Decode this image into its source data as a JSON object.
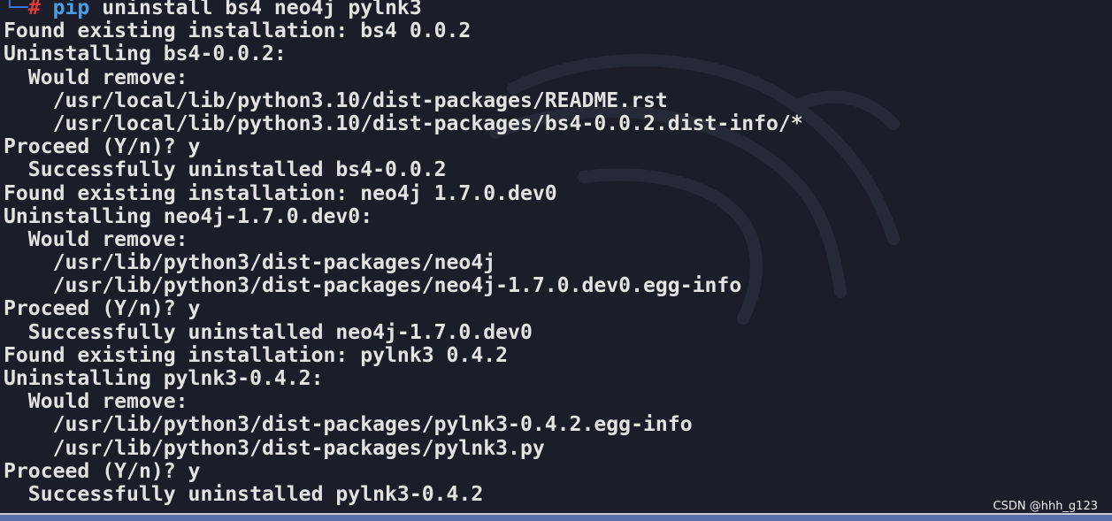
{
  "prompt": {
    "corner": "└─",
    "symbol": "#",
    "command_program": "pip",
    "command_args": " uninstall bs4 neo4j pylnk3"
  },
  "output_lines": [
    "Found existing installation: bs4 0.0.2",
    "Uninstalling bs4-0.0.2:",
    "  Would remove:",
    "    /usr/local/lib/python3.10/dist-packages/README.rst",
    "    /usr/local/lib/python3.10/dist-packages/bs4-0.0.2.dist-info/*",
    "Proceed (Y/n)? y",
    "  Successfully uninstalled bs4-0.0.2",
    "Found existing installation: neo4j 1.7.0.dev0",
    "Uninstalling neo4j-1.7.0.dev0:",
    "  Would remove:",
    "    /usr/lib/python3/dist-packages/neo4j",
    "    /usr/lib/python3/dist-packages/neo4j-1.7.0.dev0.egg-info",
    "Proceed (Y/n)? y",
    "  Successfully uninstalled neo4j-1.7.0.dev0",
    "Found existing installation: pylnk3 0.4.2",
    "Uninstalling pylnk3-0.4.2:",
    "  Would remove:",
    "    /usr/lib/python3/dist-packages/pylnk3-0.4.2.egg-info",
    "    /usr/lib/python3/dist-packages/pylnk3.py",
    "Proceed (Y/n)? y",
    "  Successfully uninstalled pylnk3-0.4.2"
  ],
  "credit": "CSDN @hhh_g123",
  "colors": {
    "background": "#1b1e28",
    "text": "#e3e3e3",
    "prompt_corner": "#3b7bd6",
    "prompt_hash": "#e33b3b",
    "command": "#4aa0e8"
  },
  "icons": {
    "watermark": "kali-dragon-icon"
  }
}
